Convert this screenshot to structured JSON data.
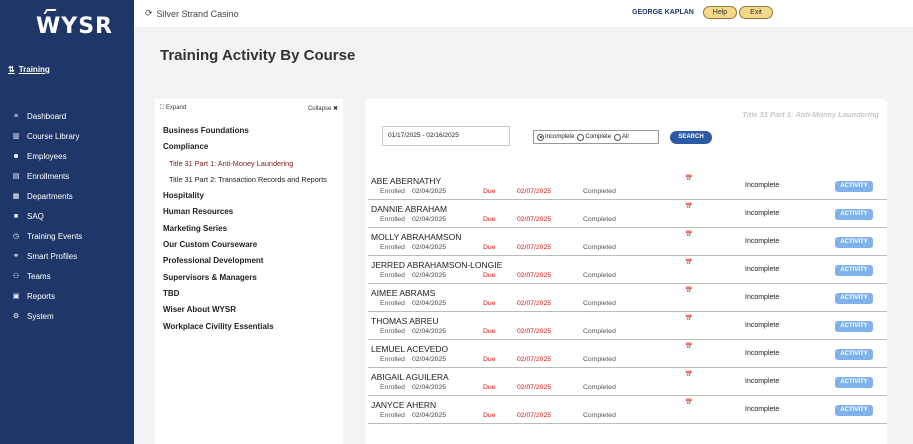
{
  "sidebar": {
    "logo": "WYSR",
    "section_label": "Training",
    "items": [
      {
        "label": "Dashboard",
        "icon": "≡"
      },
      {
        "label": "Course Library",
        "icon": "▥"
      },
      {
        "label": "Employees",
        "icon": "☻"
      },
      {
        "label": "Enrollments",
        "icon": "▤"
      },
      {
        "label": "Departments",
        "icon": "▦"
      },
      {
        "label": "SAQ",
        "icon": "■"
      },
      {
        "label": "Training Events",
        "icon": "◷"
      },
      {
        "label": "Smart Profiles",
        "icon": "⚭"
      },
      {
        "label": "Teams",
        "icon": "⚇"
      },
      {
        "label": "Reports",
        "icon": "▣"
      },
      {
        "label": "System",
        "icon": "⚙"
      }
    ]
  },
  "header": {
    "casino": "Silver Strand Casino",
    "user": "GEORGE KAPLAN",
    "help": "Help",
    "exit": "Exit"
  },
  "page_title": "Training Activity By Course",
  "course_panel": {
    "expand": "Expand",
    "collapse": "Collapse",
    "courses": [
      {
        "label": "Business Foundations",
        "sub": false
      },
      {
        "label": "Compliance",
        "sub": false
      },
      {
        "label": "Title 31 Part 1: Anti-Money Laundering",
        "sub": true,
        "active": true
      },
      {
        "label": "Title 31 Part 2: Transaction Records and Reports",
        "sub": true
      },
      {
        "label": "Hospitality",
        "sub": false
      },
      {
        "label": "Human Resources",
        "sub": false
      },
      {
        "label": "Marketing Series",
        "sub": false
      },
      {
        "label": "Our Custom Courseware",
        "sub": false
      },
      {
        "label": "Professional Development",
        "sub": false
      },
      {
        "label": "Supervisors & Managers",
        "sub": false
      },
      {
        "label": "TBD",
        "sub": false
      },
      {
        "label": "Wiser About WYSR",
        "sub": false
      },
      {
        "label": "Workplace Civility Essentials",
        "sub": false
      }
    ]
  },
  "main": {
    "course_heading": "Title 31 Part 1: Anti-Money Laundering",
    "date_range": "01/17/2025 - 02/16/2025",
    "filters": [
      "Incomplete",
      "Complete",
      "All"
    ],
    "search_label": "SEARCH",
    "labels": {
      "enrolled": "Enrolled",
      "due": "Due",
      "completed": "Completed",
      "activity": "ACTIVITY"
    },
    "rows": [
      {
        "name": "ABE ABERNATHY",
        "enrolled": "02/04/2025",
        "due": "02/07/2025",
        "status": "Incomplete"
      },
      {
        "name": "DANNIE ABRAHAM",
        "enrolled": "02/04/2025",
        "due": "02/07/2025",
        "status": "Incomplete"
      },
      {
        "name": "MOLLY ABRAHAMSON",
        "enrolled": "02/04/2025",
        "due": "02/07/2025",
        "status": "Incomplete"
      },
      {
        "name": "JERRED ABRAHAMSON-LONGIE",
        "enrolled": "02/04/2025",
        "due": "02/07/2025",
        "status": "Incomplete"
      },
      {
        "name": "AIMEE ABRAMS",
        "enrolled": "02/04/2025",
        "due": "02/07/2025",
        "status": "Incomplete"
      },
      {
        "name": "THOMAS ABREU",
        "enrolled": "02/04/2025",
        "due": "02/07/2025",
        "status": "Incomplete"
      },
      {
        "name": "LEMUEL ACEVEDO",
        "enrolled": "02/04/2025",
        "due": "02/07/2025",
        "status": "Incomplete"
      },
      {
        "name": "ABIGAIL AGUILERA",
        "enrolled": "02/04/2025",
        "due": "02/07/2025",
        "status": "Incomplete"
      },
      {
        "name": "JANYCE AHERN",
        "enrolled": "02/04/2025",
        "due": "02/07/2025",
        "status": "Incomplete"
      }
    ]
  }
}
